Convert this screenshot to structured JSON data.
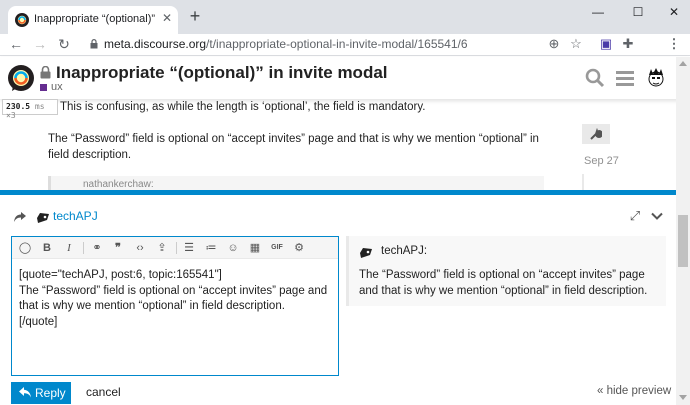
{
  "browser": {
    "tab_title": "Inappropriate “(optional)” in invit",
    "tab_close": "✕",
    "new_tab": "+",
    "window_controls": {
      "minimize": "—",
      "maximize": "☐",
      "close": "✕"
    },
    "url_host": "meta.discourse.org",
    "url_path": "/t/inappropriate-optional-in-invite-modal/165541/6"
  },
  "header": {
    "title": "Inappropriate “(optional)” in invite modal",
    "category": "ux",
    "category_color": "#652d90"
  },
  "perf": {
    "ms": "230.5",
    "unit": "ms",
    "mult": "×3"
  },
  "post": {
    "line1": "This is confusing, as while the length is ‘optional’, the field is mandatory.",
    "para2": "The “Password” field is optional on “accept invites” page and that is why we mention “optional” in field description.",
    "quote_partial": "nathankerchaw:"
  },
  "timeline": {
    "date": "Sep 27"
  },
  "composer": {
    "reply_to_user": "techAPJ",
    "editor_text": "[quote=\"techAPJ, post:6, topic:165541\"]\nThe “Password” field is optional on “accept invites” page and that is why we mention “optional” in field description.\n[/quote]",
    "preview_user": "techAPJ:",
    "preview_text": "The “Password” field is optional on “accept invites” page and that is why we mention “optional” in field description.",
    "reply_label": "Reply",
    "cancel_label": "cancel",
    "hide_preview_label": "« hide preview",
    "gif_label": "GIF",
    "accent": "#0088cc"
  }
}
